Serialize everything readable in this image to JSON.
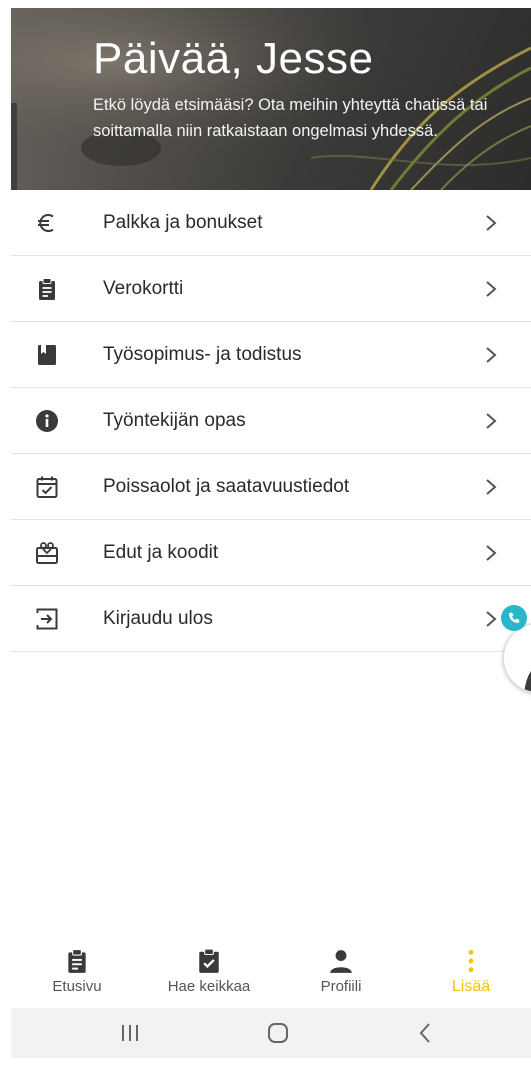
{
  "header": {
    "greeting": "Päivää, Jesse",
    "help_text": "Etkö löydä etsimääsi? Ota meihin yhteyttä chatissä tai soittamalla niin ratkaistaan ongelmasi yhdessä."
  },
  "menu": {
    "items": [
      {
        "label": "Palkka ja bonukset",
        "icon": "euro-icon"
      },
      {
        "label": "Verokortti",
        "icon": "clipboard-icon"
      },
      {
        "label": "Työsopimus- ja todistus",
        "icon": "book-icon"
      },
      {
        "label": "Työntekijän opas",
        "icon": "info-icon"
      },
      {
        "label": "Poissaolot ja saatavuustiedot",
        "icon": "calendar-check-icon"
      },
      {
        "label": "Edut ja koodit",
        "icon": "gift-card-icon"
      },
      {
        "label": "Kirjaudu ulos",
        "icon": "logout-icon"
      }
    ]
  },
  "bottom_nav": {
    "items": [
      {
        "label": "Etusivu",
        "icon": "clipboard-icon"
      },
      {
        "label": "Hae keikkaa",
        "icon": "clipboard-check-icon"
      },
      {
        "label": "Profiili",
        "icon": "person-icon"
      },
      {
        "label": "Lisää",
        "icon": "more-vertical-icon",
        "active": true
      }
    ]
  },
  "colors": {
    "accent": "#f2c40d",
    "call_badge": "#29b6c9",
    "icon": "#3a3a3a"
  }
}
